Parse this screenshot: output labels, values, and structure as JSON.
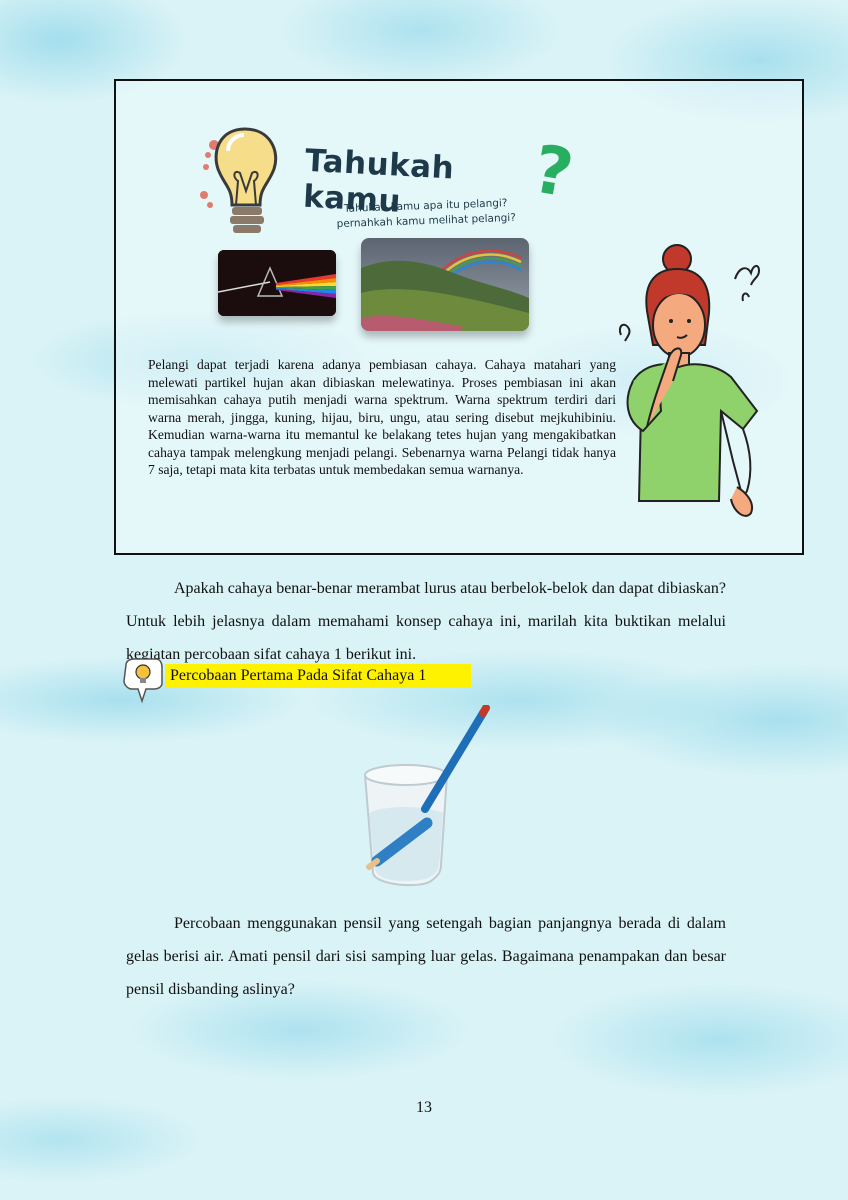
{
  "infobox": {
    "title": "Tahukah kamu",
    "question_line1": "Tahukah kamu apa itu pelangi?",
    "question_line2": "pernahkah kamu melihat pelangi?",
    "paragraph": "Pelangi dapat terjadi karena adanya pembiasan cahaya. Cahaya matahari yang melewati partikel hujan akan dibiaskan melewatinya. Proses pembiasan ini akan memisahkan cahaya putih menjadi warna spektrum. Warna spektrum terdiri dari warna merah, jingga, kuning, hijau, biru, ungu, atau sering disebut mejkuhibiniu. Kemudian warna-warna itu memantul ke belakang tetes hujan yang mengakibatkan cahaya tampak melengkung menjadi pelangi. Sebenarnya warna Pelangi tidak hanya 7 saja, tetapi mata kita terbatas untuk membedakan semua warnanya."
  },
  "body": {
    "paragraph1": "Apakah cahaya benar-benar merambat lurus atau berbelok-belok dan dapat dibiaskan? Untuk lebih jelasnya dalam memahami konsep cahaya ini, marilah kita buktikan melalui kegiatan percobaan sifat cahaya 1 berikut ini.",
    "section_heading": "Percobaan Pertama Pada Sifat Cahaya 1",
    "paragraph2": "Percobaan menggunakan pensil yang setengah bagian panjangnya berada di dalam gelas berisi air. Amati pensil dari sisi samping luar gelas. Bagaimana penampakan dan besar pensil disbanding aslinya?"
  },
  "page_number": "13",
  "colors": {
    "background": "#d9f3f6",
    "highlight": "#fff200",
    "title_text": "#1e3a4a",
    "question_mark": "#27ae60"
  },
  "icons": [
    "lightbulb-icon",
    "question-mark-icon",
    "idea-callout-icon"
  ]
}
